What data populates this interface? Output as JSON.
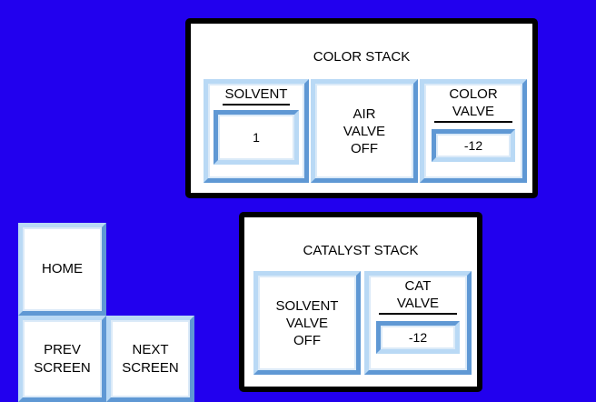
{
  "colors": {
    "background": "#2200ee",
    "button_bevel_light": "#b9d9f5",
    "button_bevel_dark": "#5f98d4",
    "panel_border": "#000000"
  },
  "color_stack": {
    "title": "COLOR STACK",
    "solvent": {
      "label": "SOLVENT",
      "value": "1"
    },
    "air_valve": {
      "line1": "AIR",
      "line2": "VALVE",
      "state": "OFF"
    },
    "color_valve": {
      "line1": "COLOR",
      "line2": "VALVE",
      "value": "-12"
    }
  },
  "catalyst_stack": {
    "title": "CATALYST STACK",
    "solvent_valve": {
      "line1": "SOLVENT",
      "line2": "VALVE",
      "state": "OFF"
    },
    "cat_valve": {
      "line1": "CAT",
      "line2": "VALVE",
      "value": "-12"
    }
  },
  "nav": {
    "home": "HOME",
    "prev": {
      "line1": "PREV",
      "line2": "SCREEN"
    },
    "next": {
      "line1": "NEXT",
      "line2": "SCREEN"
    }
  }
}
